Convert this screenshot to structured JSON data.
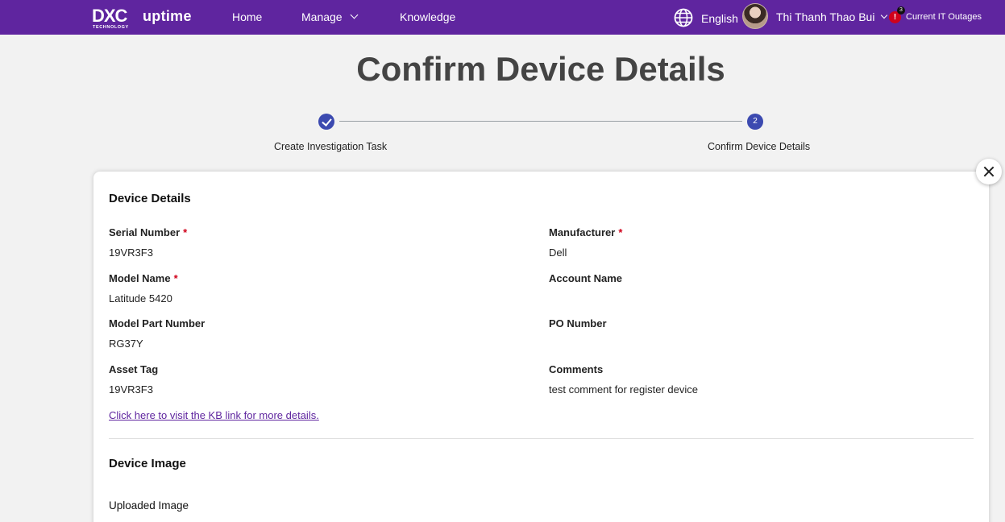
{
  "nav": {
    "logo_mark": "DXC",
    "logo_sub": "TECHNOLOGY",
    "logo_product": "uptime",
    "home": "Home",
    "manage": "Manage",
    "knowledge": "Knowledge",
    "language": "English",
    "user_name": "Thi Thanh Thao Bui",
    "alert_symbol": "!",
    "alert_count": "3",
    "outages": "Current IT Outages"
  },
  "page": {
    "title": "Confirm Device Details"
  },
  "stepper": {
    "steps": [
      {
        "label": "Create Investigation Task",
        "state": "done",
        "number": ""
      },
      {
        "label": "Confirm Device Details",
        "state": "active",
        "number": "2"
      }
    ]
  },
  "device_details": {
    "title": "Device Details",
    "fields": {
      "serial_number": {
        "label": "Serial Number",
        "value": "19VR3F3",
        "required": true
      },
      "manufacturer": {
        "label": "Manufacturer",
        "value": "Dell",
        "required": true
      },
      "model_name": {
        "label": "Model Name",
        "value": "Latitude 5420",
        "required": true
      },
      "account_name": {
        "label": "Account Name",
        "value": ""
      },
      "model_part_number": {
        "label": "Model Part Number",
        "value": "RG37Y"
      },
      "po_number": {
        "label": "PO Number",
        "value": ""
      },
      "asset_tag": {
        "label": "Asset Tag",
        "value": "19VR3F3"
      },
      "comments": {
        "label": "Comments",
        "value": "test comment for register device"
      }
    },
    "required_marker": "*",
    "kb_link": "Click here to visit the KB link for more details."
  },
  "device_image": {
    "title": "Device Image",
    "uploaded_label": "Uploaded Image"
  },
  "colors": {
    "brand": "#5f259f",
    "step": "#3c4ab0",
    "required": "#d0021b"
  }
}
